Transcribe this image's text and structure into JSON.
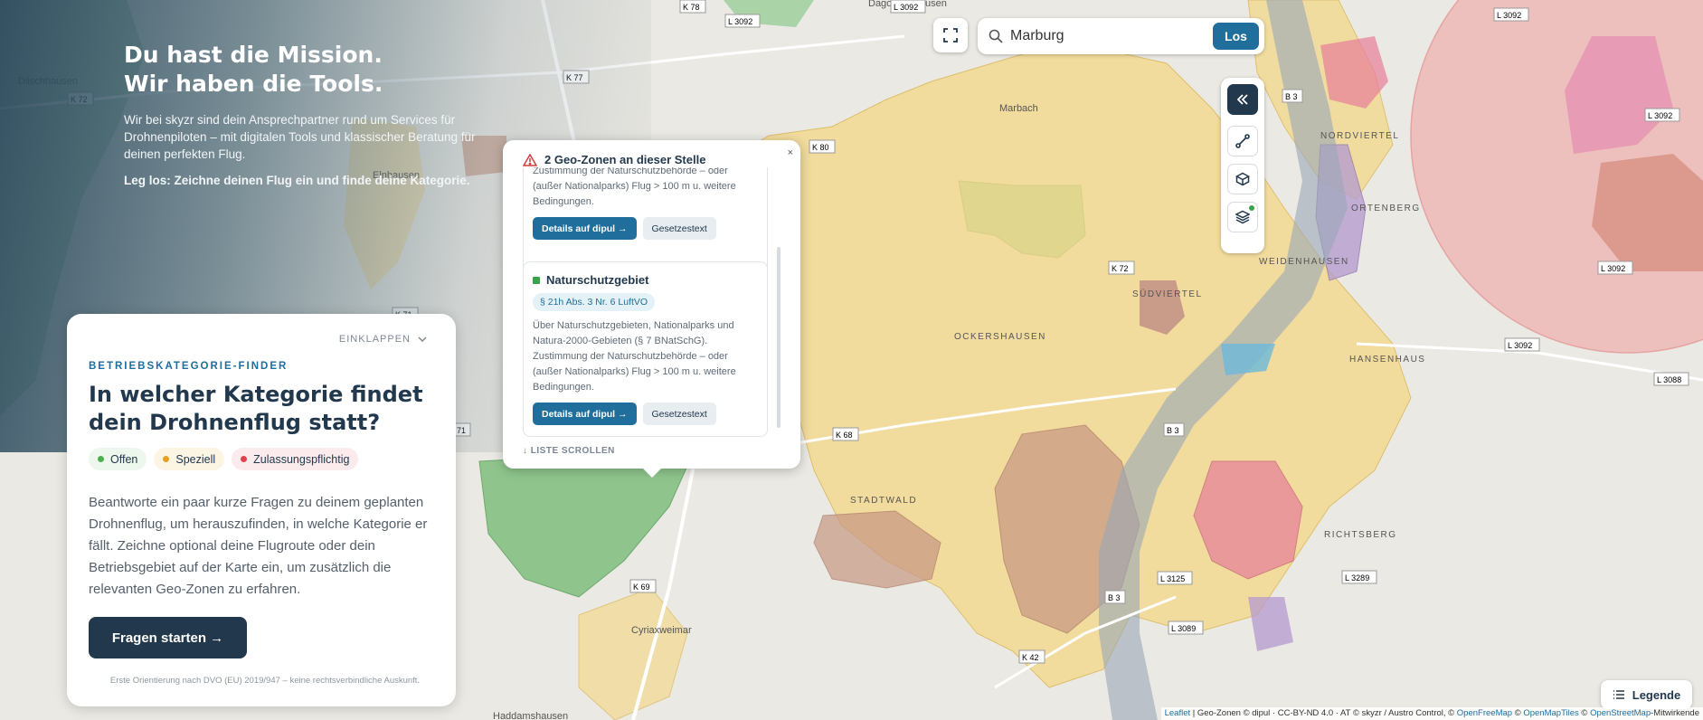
{
  "hero": {
    "title_line1": "Du hast die Mission.",
    "title_line2": "Wir haben die Tools.",
    "description": "Wir bei skyzr sind dein Ansprechpartner rund um Services für Drohnenpiloten – mit digitalen Tools und klassischer Beratung für deinen perfekten Flug.",
    "cta": "Leg los: Zeichne deinen Flug ein und finde deine Kategorie."
  },
  "search": {
    "value": "Marburg",
    "button": "Los",
    "icon": "search-icon"
  },
  "toolbar": {
    "icons": [
      "double-chevron-left-icon",
      "route-line-icon",
      "box-icon",
      "layers-icon"
    ],
    "active_dot_color": "#3aa34a"
  },
  "popup": {
    "title": "2 Geo-Zonen an dieser Stelle",
    "close": "×",
    "zones": [
      {
        "text": "Zustimmung der Naturschutzbehörde – oder (außer Nationalparks) Flug > 100 m u. weitere Bedingungen.",
        "details_button": "Details auf dipul →",
        "law_button": "Gesetzestext"
      },
      {
        "title": "Naturschutzgebiet",
        "law": "§ 21h Abs. 3 Nr. 6 LuftVO",
        "text": "Über Naturschutzgebieten, Nationalparks und Natura-2000-Gebieten (§ 7 BNatSchG). Zustimmung der Naturschutzbehörde – oder (außer Nationalparks) Flug > 100 m u. weitere Bedingungen.",
        "details_button": "Details auf dipul →",
        "law_button": "Gesetzestext",
        "color": "#3aa34a"
      }
    ],
    "scroll_hint": "LISTE SCROLLEN"
  },
  "finder": {
    "collapse": "EINKLAPPEN",
    "eyebrow": "BETRIEBSKATEGORIE-FINDER",
    "title": "In welcher Kategorie findet dein Drohnenflug statt?",
    "chips": [
      {
        "label": "Offen",
        "color": "#4caf50",
        "bg": "#eef7ee"
      },
      {
        "label": "Speziell",
        "color": "#e8a020",
        "bg": "#fdf5e4"
      },
      {
        "label": "Zulassungspflichtig",
        "color": "#e0434b",
        "bg": "#fcebec"
      }
    ],
    "description": "Beantworte ein paar kurze Fragen zu deinem geplanten Drohnenflug, um herauszufinden, in welche Kategorie er fällt. Zeichne optional deine Flugroute oder dein Betriebsgebiet auf der Karte ein, um zusätzlich die relevanten Geo-Zonen zu erfahren.",
    "start_button": "Fragen starten →",
    "disclaimer": "Erste Orientierung nach DVO (EU) 2019/947 – keine rechtsverbindliche Auskunft."
  },
  "legend_button": "Legende",
  "attribution": {
    "leaflet": "Leaflet",
    "text1": " | Geo-Zonen © dipul · CC-BY-ND 4.0 · AT © skyzr / Austro Control, © ",
    "openfreemap": "OpenFreeMap",
    "text2": " © ",
    "openmaptiles": "OpenMapTiles",
    "text3": " © ",
    "openstreetmap": "OpenStreetMap",
    "text4": "-Mitwirkende"
  },
  "map_labels": {
    "places": [
      "Dilschhausen",
      "Dagobertshausen",
      "Marbach",
      "Elnhausen",
      "Ockershausen",
      "Südviertel",
      "Weidenhausen",
      "Ortenberg",
      "Hansenhaus",
      "Richtsberg",
      "Stadtwald",
      "Cyriaxweimar",
      "Haddamshausen",
      "Nordviertel"
    ],
    "roads": [
      "K 78",
      "K 77",
      "K 72",
      "L 3092",
      "L 3092",
      "L 3092",
      "L 3092",
      "L 3092",
      "K 80",
      "K 72",
      "K 71",
      "K 68",
      "K 69",
      "K 42",
      "B 3",
      "B 3",
      "B 3",
      "L 3125",
      "L 3089",
      "L 3088",
      "L 3289",
      "L 3092",
      "71"
    ]
  }
}
